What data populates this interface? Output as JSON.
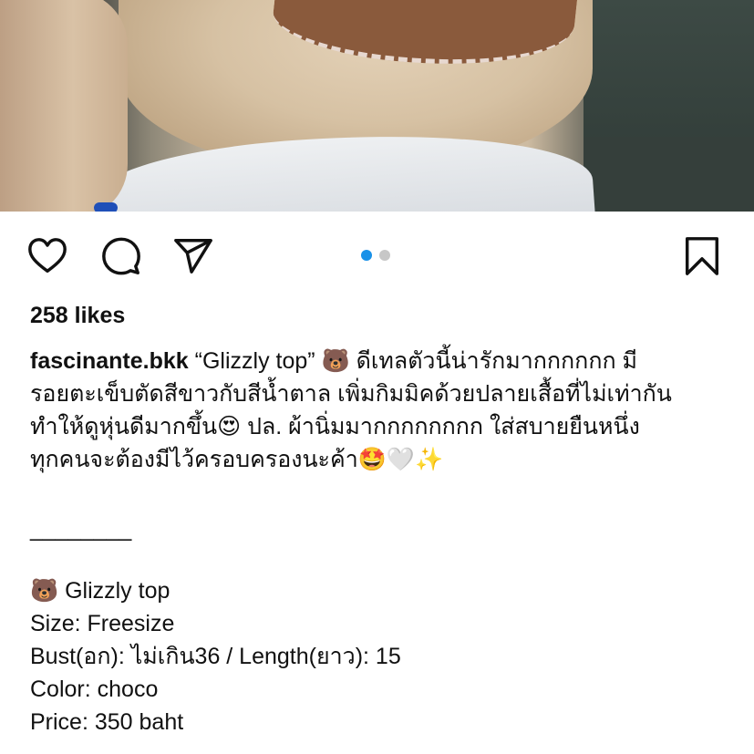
{
  "post": {
    "likes": "258 likes",
    "username": "fascinante.bkk",
    "caption_lines": [
      "“Glizzly top” 🐻 ดีเทลตัวนี้น่ารักมากกกกกก มี",
      "รอยตะเข็บตัดสีขาวกับสีน้ำตาล เพิ่มกิมมิคด้วยปลายเสื้อที่ไม่เท่ากัน",
      "ทำให้ดูหุ่นดีมากขึ้น😍 ปล. ผ้านิ่มมากกกกกกกก ใส่สบายยืนหนึ่ง",
      "ทุกคนจะต้องมีไว้ครอบครองนะค้า🤩🤍✨"
    ],
    "divider": "________",
    "details": [
      "🐻 Glizzly top",
      "Size: Freesize",
      "Bust(อก): ไม่เกิน36 / Length(ยาว): 15",
      "Color: choco",
      "Price: 350 baht"
    ]
  },
  "carousel": {
    "total": 2,
    "active_index": 0
  },
  "icons": {
    "like": "heart-icon",
    "comment": "comment-bubble-icon",
    "share": "paper-plane-icon",
    "save": "bookmark-icon"
  },
  "colors": {
    "accent": "#1991e8",
    "text": "#111111",
    "dot_inactive": "#c7c7c7"
  }
}
